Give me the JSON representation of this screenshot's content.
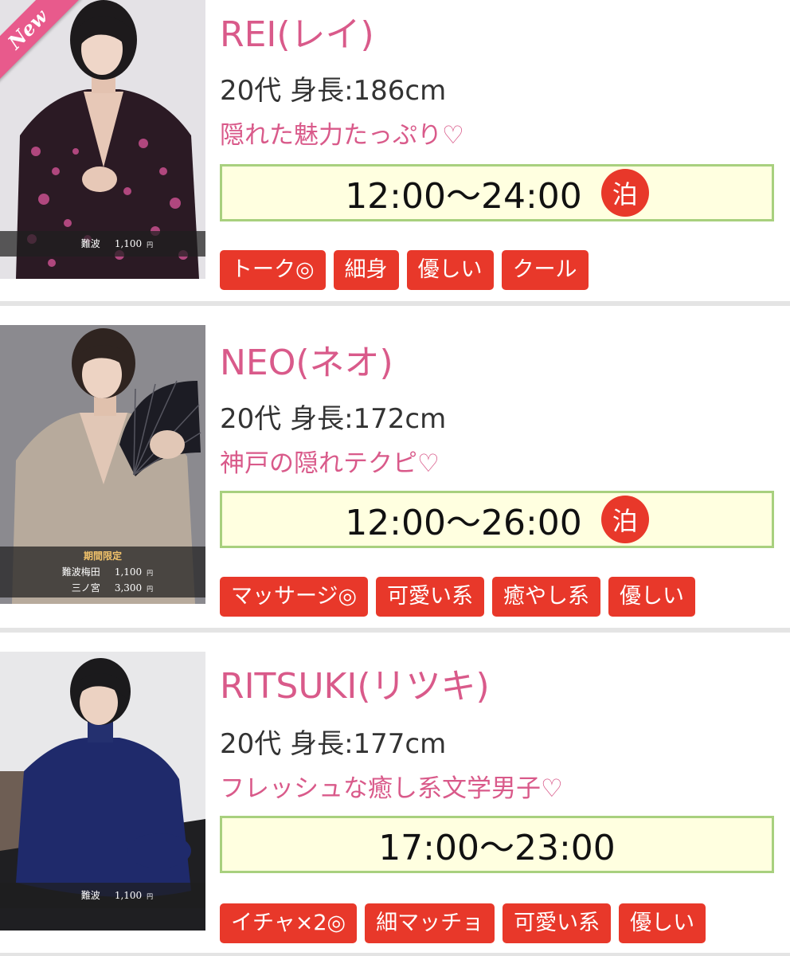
{
  "casts": [
    {
      "name": "REI(レイ)",
      "info": "20代 身長:186cm",
      "catch": "隠れた魅力たっぷり♡",
      "hours": "12:00〜24:00",
      "stay": "泊",
      "badge": "New",
      "photo_prices": [
        {
          "location": "難波",
          "price": "1,100",
          "unit": "円"
        }
      ],
      "tags": [
        "トーク◎",
        "細身",
        "優しい",
        "クール"
      ]
    },
    {
      "name": "NEO(ネオ)",
      "info": "20代 身長:172cm",
      "catch": "神戸の隠れテクピ♡",
      "hours": "12:00〜26:00",
      "stay": "泊",
      "photo_period": "期間限定",
      "photo_prices": [
        {
          "location": "難波梅田",
          "price": "1,100",
          "unit": "円"
        },
        {
          "location": "三ノ宮",
          "price": "3,300",
          "unit": "円"
        }
      ],
      "tags": [
        "マッサージ◎",
        "可愛い系",
        "癒やし系",
        "優しい"
      ]
    },
    {
      "name": "RITSUKI(リツキ)",
      "info": "20代 身長:177cm",
      "catch": "フレッシュな癒し系文学男子♡",
      "hours": "17:00〜23:00",
      "photo_prices": [
        {
          "location": "難波",
          "price": "1,100",
          "unit": "円"
        }
      ],
      "tags": [
        "イチャ×2◎",
        "細マッチョ",
        "可愛い系",
        "優しい"
      ]
    }
  ],
  "colors": {
    "pink": "#d95a8a",
    "tag_red": "#e8382a",
    "hours_bg": "#ffffe0",
    "hours_border": "#a8d07e",
    "separator": "#e4e4e4"
  }
}
